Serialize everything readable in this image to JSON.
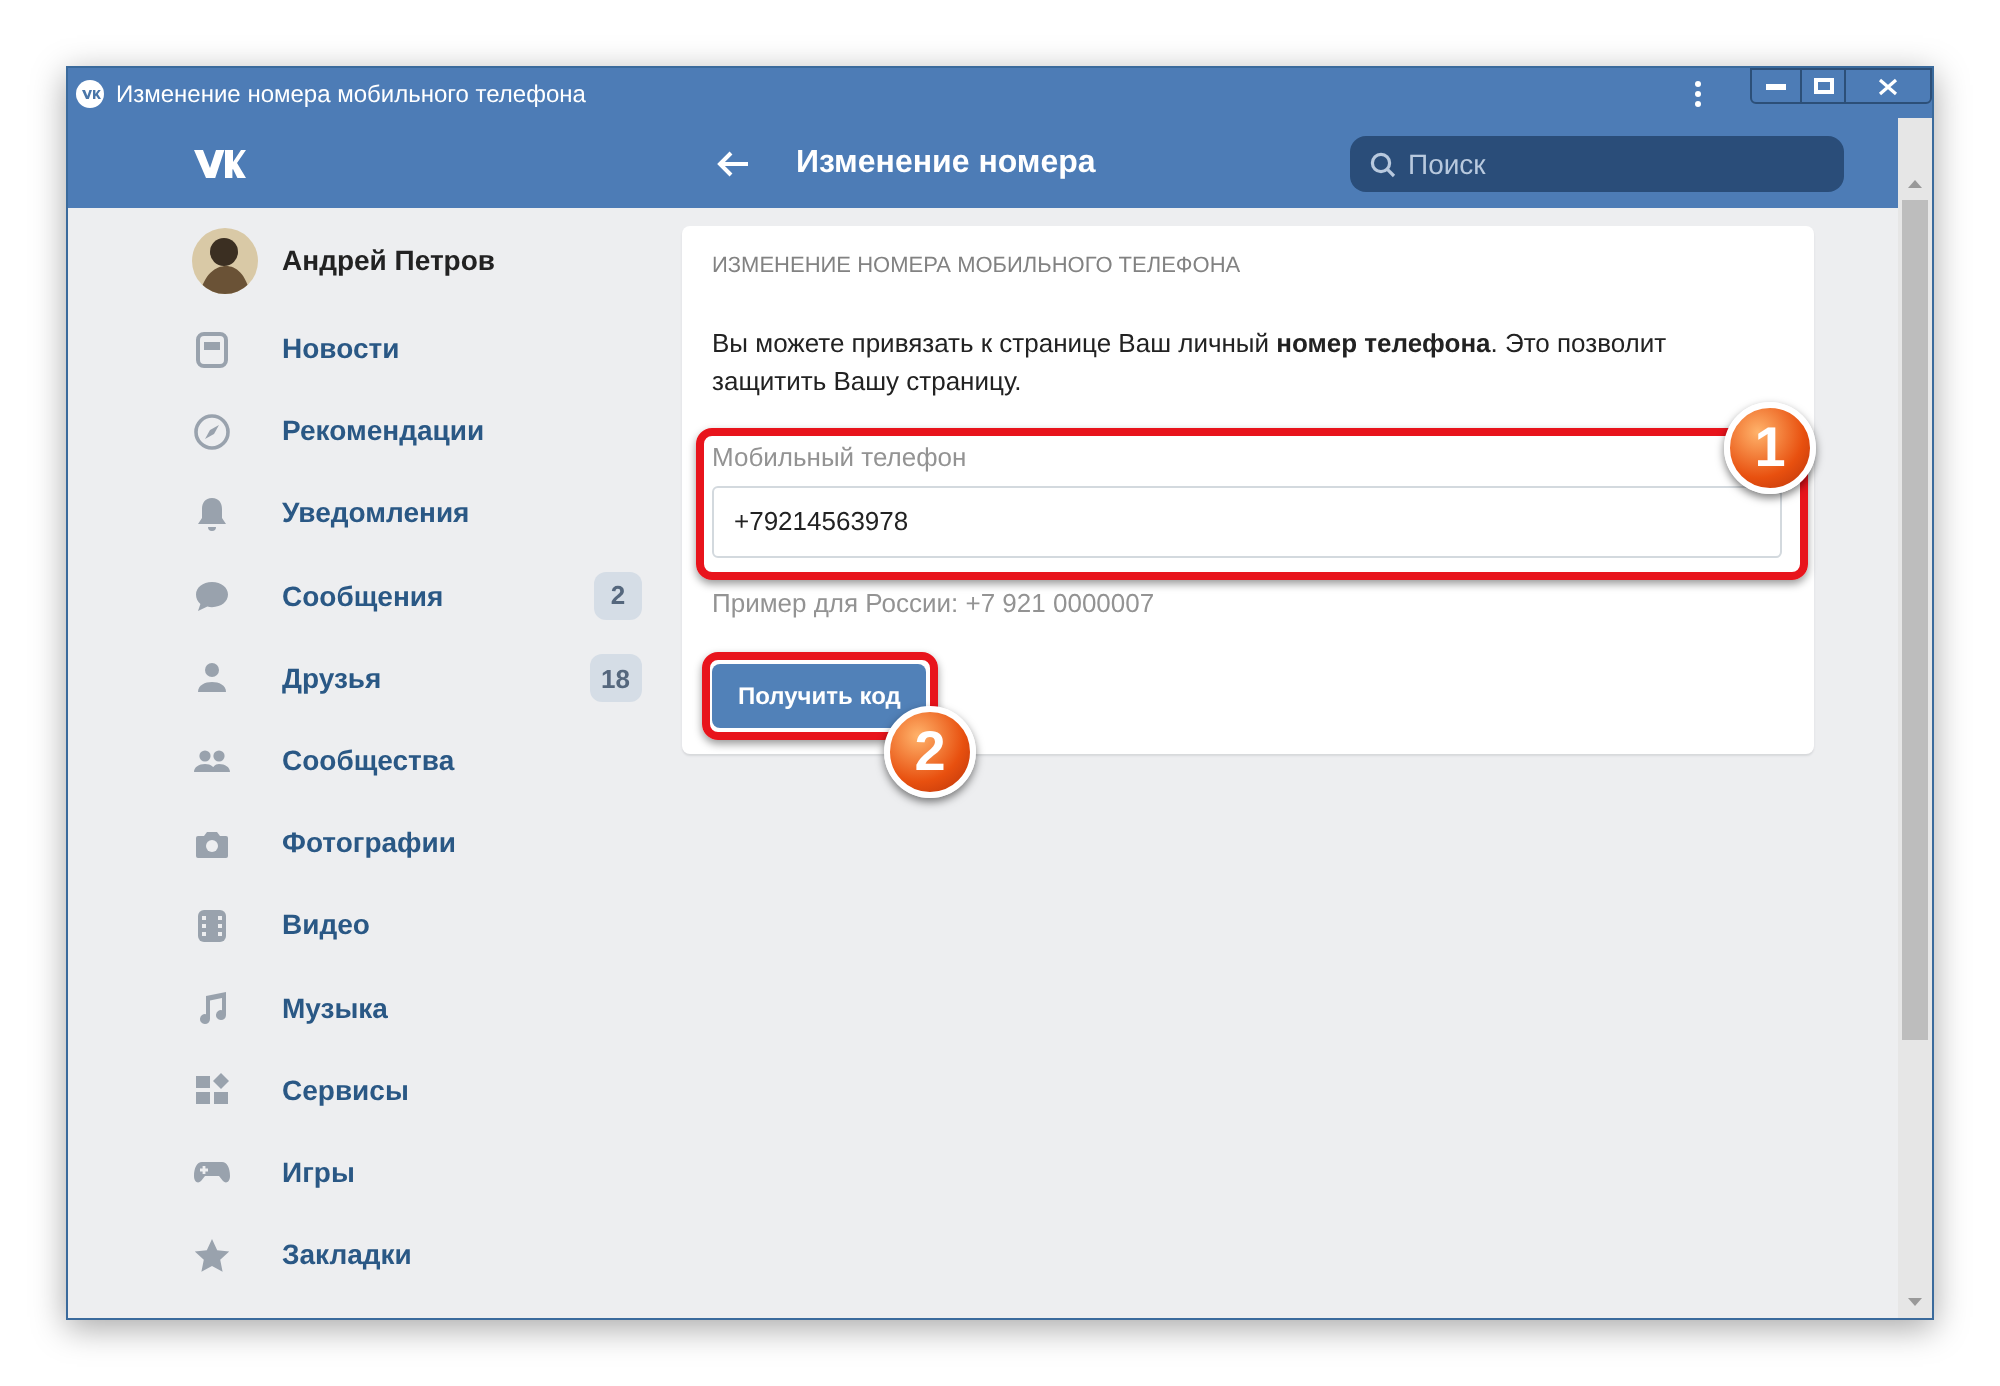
{
  "window": {
    "title": "Изменение номера мобильного телефона"
  },
  "header": {
    "title": "Изменение номера",
    "search": {
      "placeholder": "Поиск"
    }
  },
  "sidebar": {
    "profile": {
      "name": "Андрей Петров"
    },
    "items": [
      {
        "label": "Новости"
      },
      {
        "label": "Рекомендации"
      },
      {
        "label": "Уведомления"
      },
      {
        "label": "Сообщения",
        "badge": "2"
      },
      {
        "label": "Друзья",
        "badge": "18"
      },
      {
        "label": "Сообщества"
      },
      {
        "label": "Фотографии"
      },
      {
        "label": "Видео"
      },
      {
        "label": "Музыка"
      },
      {
        "label": "Сервисы"
      },
      {
        "label": "Игры"
      },
      {
        "label": "Закладки"
      }
    ]
  },
  "card": {
    "heading": "ИЗМЕНЕНИЕ НОМЕРА МОБИЛЬНОГО ТЕЛЕФОНА",
    "description": "Вы можете привязать к странице Ваш личный **номер телефона**. Это позволит защитить Вашу страницу.",
    "field": {
      "label": "Мобильный телефон",
      "value": "+79214563978"
    },
    "hint": "Пример для России: +7 921 0000007",
    "button": "Получить код"
  },
  "annotations": [
    {
      "label": "1"
    },
    {
      "label": "2"
    }
  ]
}
